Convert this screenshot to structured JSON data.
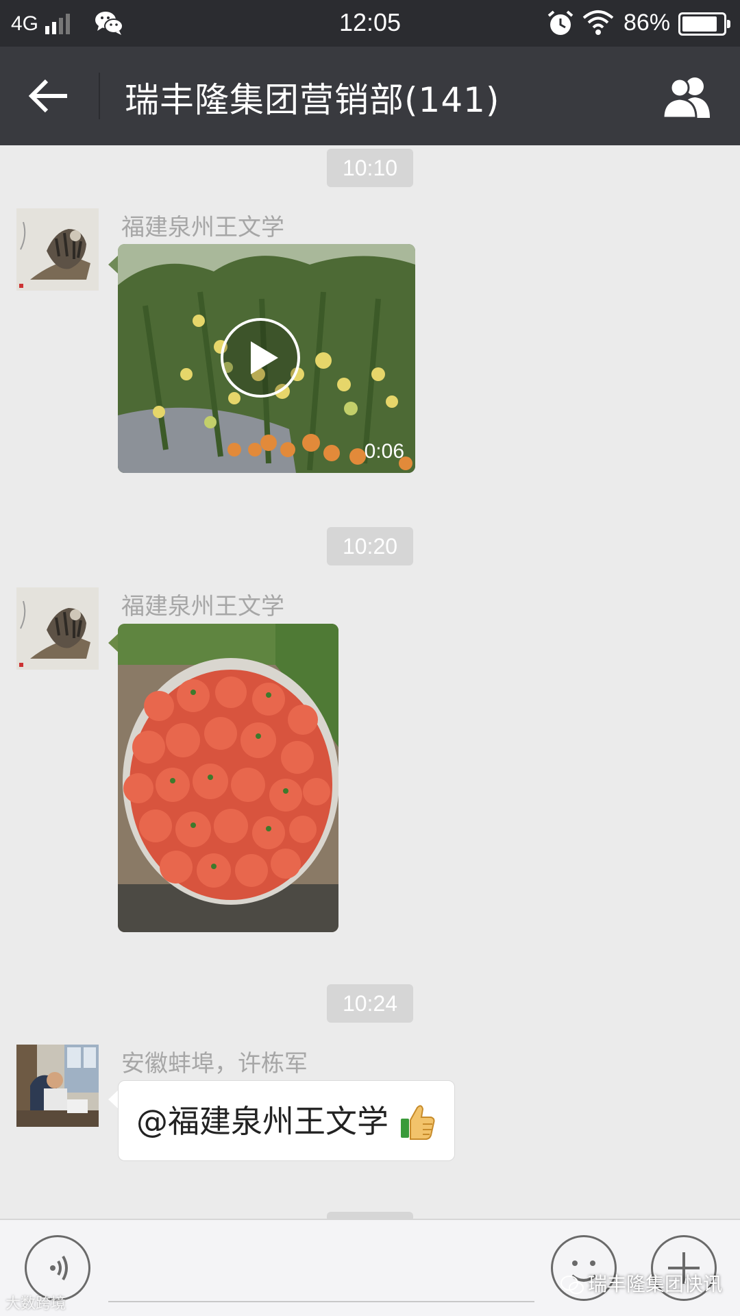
{
  "status_bar": {
    "carrier": "4G",
    "time": "12:05",
    "battery": "86%",
    "battery_level": 0.86
  },
  "header": {
    "title": "瑞丰隆集团营销部(141)"
  },
  "messages": [
    {
      "timestamp": "10:10",
      "sender": "福建泉州王文学",
      "type": "video",
      "duration": "0:06"
    },
    {
      "timestamp": "10:20",
      "sender": "福建泉州王文学",
      "type": "image"
    },
    {
      "timestamp": "10:24",
      "sender": "安徽蚌埠，许栋军",
      "type": "text",
      "text": "@福建泉州王文学"
    }
  ],
  "watermarks": {
    "left": "大数跨境",
    "right": "瑞丰隆集团快讯"
  },
  "colors": {
    "status_bar": "#2b2c30",
    "header": "#393a3f",
    "chat_bg": "#ebebeb",
    "timestamp_bg": "#d6d6d6"
  }
}
